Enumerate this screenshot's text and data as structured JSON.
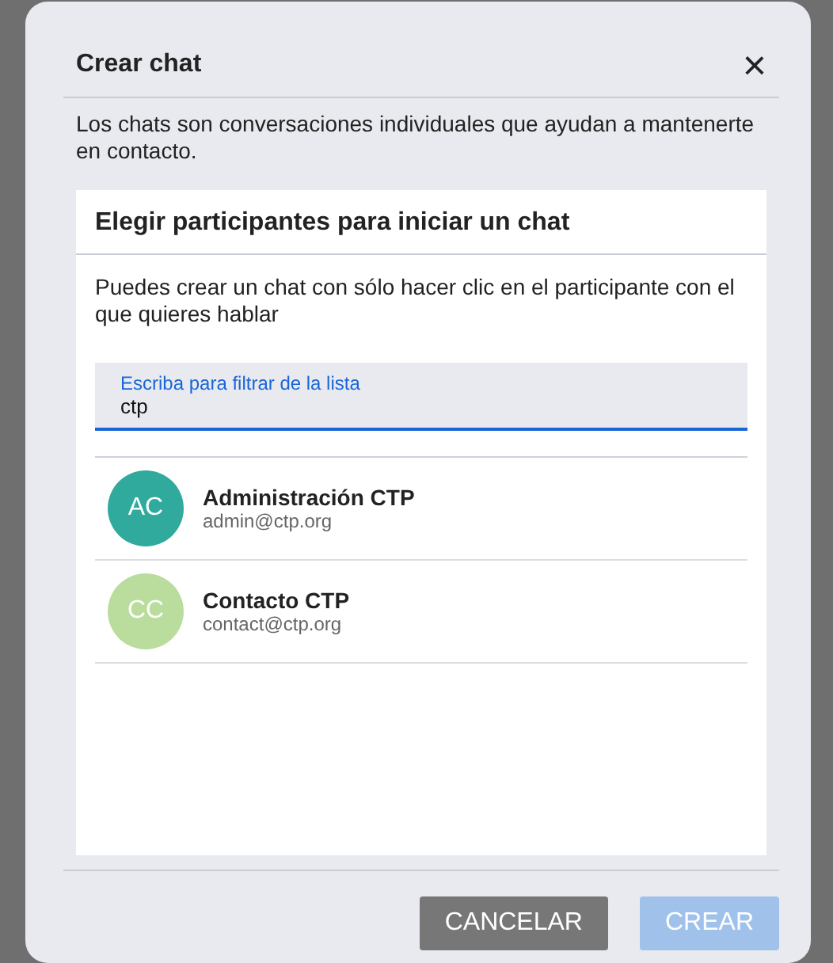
{
  "dialog": {
    "title": "Crear chat",
    "close_icon": "×",
    "description": "Los chats son conversaciones individuales que ayudan a mantenerte en contacto."
  },
  "panel": {
    "heading": "Elegir participantes para iniciar un chat",
    "hint": "Puedes crear un chat con sólo hacer clic en el participante con el que quieres hablar",
    "filter": {
      "label": "Escriba para filtrar de la lista",
      "value": "ctp"
    },
    "participants": [
      {
        "initials": "AC",
        "name": "Administración CTP",
        "email": "admin@ctp.org",
        "color": "#2faa9c"
      },
      {
        "initials": "CC",
        "name": "Contacto CTP",
        "email": "contact@ctp.org",
        "color": "#badd9e"
      }
    ]
  },
  "buttons": [
    {
      "label": "CANCELAR",
      "kind": "secondary",
      "disabled": false
    },
    {
      "label": "CREAR",
      "kind": "primary",
      "disabled": true
    }
  ]
}
